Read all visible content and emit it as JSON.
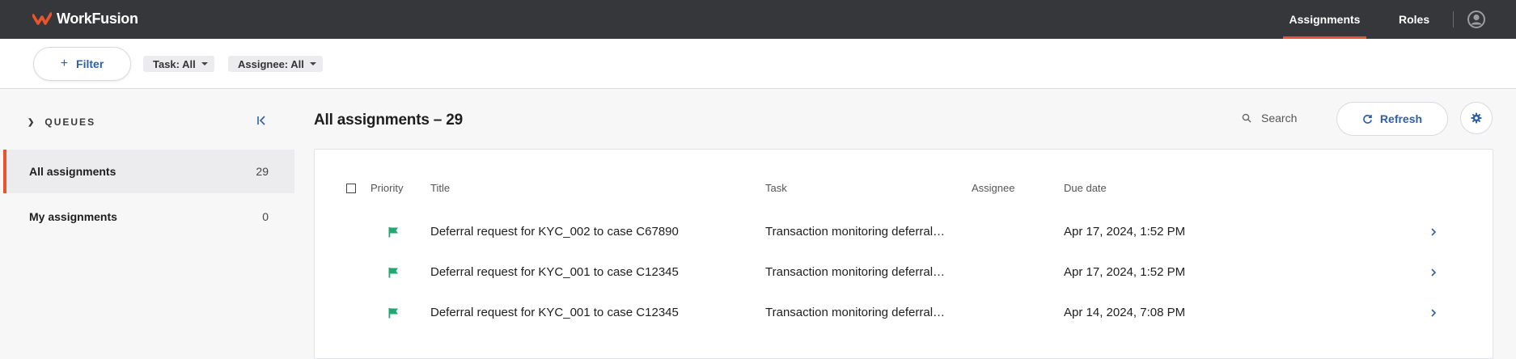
{
  "app": {
    "brand": "WorkFusion",
    "brand_color": "#e8542b",
    "nav": {
      "assignments": "Assignments",
      "roles": "Roles"
    }
  },
  "filters": {
    "filter_label": "Filter",
    "task_chip": "Task: All",
    "assignee_chip": "Assignee: All"
  },
  "sidebar": {
    "heading": "QUEUES",
    "items": [
      {
        "label": "All assignments",
        "count": "29",
        "selected": true
      },
      {
        "label": "My assignments",
        "count": "0",
        "selected": false
      }
    ]
  },
  "main": {
    "title": "All assignments – 29",
    "search_placeholder": "Search",
    "refresh_label": "Refresh",
    "columns": {
      "priority": "Priority",
      "title": "Title",
      "task": "Task",
      "assignee": "Assignee",
      "due_date": "Due date"
    },
    "rows": [
      {
        "title": "Deferral request for KYC_002 to case C67890",
        "task": "Transaction monitoring deferral…",
        "assignee": "",
        "due": "Apr 17, 2024, 1:52 PM",
        "priority_icon": "flag-icon"
      },
      {
        "title": "Deferral request for KYC_001 to case C12345",
        "task": "Transaction monitoring deferral…",
        "assignee": "",
        "due": "Apr 17, 2024, 1:52 PM",
        "priority_icon": "flag-icon"
      },
      {
        "title": "Deferral request for KYC_001 to case C12345",
        "task": "Transaction monitoring deferral…",
        "assignee": "",
        "due": "Apr 14, 2024, 7:08 PM",
        "priority_icon": "flag-icon"
      }
    ]
  },
  "colors": {
    "topbar": "#35373b",
    "accent_blue": "#2f5fa7",
    "flag_green": "#1fa971"
  }
}
